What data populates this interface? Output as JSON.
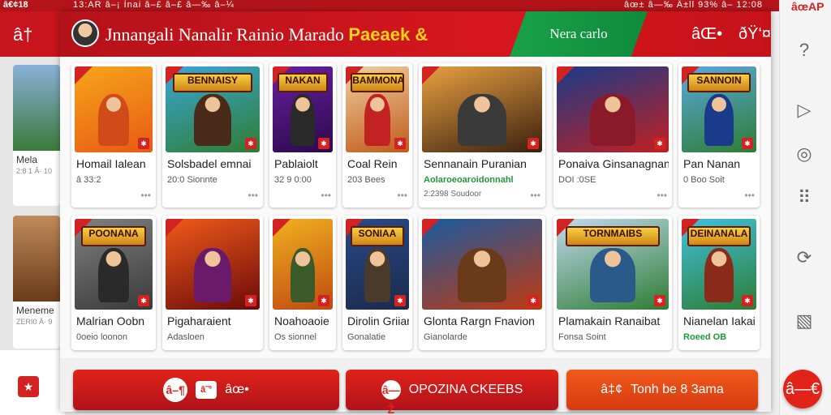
{
  "status_bar": {
    "left": "â€¢18",
    "middle": "13:AR â–¡ Ìnai  â–£ â–£ â—‰ â–¼",
    "right": "âœ± â—‰ Ä±ll 93% â–­ 12:08"
  },
  "rail": {
    "top_label": "âœAP",
    "icons": [
      "help-icon",
      "play-icon",
      "camera-icon",
      "grid-icon",
      "refresh-icon",
      "tag-icon"
    ],
    "fab_icon": "â—€"
  },
  "background_app": {
    "back_icon": "â†",
    "cards": [
      {
        "title": "Mela",
        "subtitle": "2:8 1 Â· 10"
      },
      {
        "title": "Meneme",
        "subtitle": "ZERI0 Â· 9"
      }
    ]
  },
  "header": {
    "title": "Jnnangali Nanalir Rainio Marado",
    "title_accent": "Paeaek &",
    "green_tab_label": "Nera carlo",
    "search_icon": "âŒ•",
    "profile_icon": "ðŸ‘¤"
  },
  "games": [
    {
      "name": "Homail Ialean",
      "meta": "â­ 33:2",
      "banner": "",
      "colors": [
        "#f6a51a",
        "#e85a14"
      ],
      "hero": "#d04a1a"
    },
    {
      "name": "Solsbadel emnai",
      "meta": "20:0 Sionnte",
      "banner": "BENNAISY",
      "colors": [
        "#3aa6d6",
        "#2e7d32"
      ],
      "hero": "#4a2a18"
    },
    {
      "name": "Pablaiolt",
      "meta": "32 9 0:00",
      "banner": "NAKAN",
      "colors": [
        "#6a1fa2",
        "#2a0a4a"
      ],
      "hero": "#2a2a2a"
    },
    {
      "name": "Coal Rein",
      "meta": "203 Bees",
      "banner": "BAMMONA",
      "colors": [
        "#f0d0a0",
        "#c05a1a"
      ],
      "hero": "#c22222"
    },
    {
      "name": "Sennanain Puranian",
      "meta": "Aolaroeoaroidonnahl",
      "sub": "2:2398 Soudoor",
      "banner": "",
      "colors": [
        "#e8a040",
        "#3a2010"
      ],
      "hero": "#3a3a3a",
      "meta_green": true
    },
    {
      "name": "Ponaiva Ginsanagnan",
      "meta": "DOI :0SE",
      "banner": "",
      "colors": [
        "#1a3a8a",
        "#c02020"
      ],
      "hero": "#8a1a2a"
    },
    {
      "name": "Pan Nanan",
      "meta": "0 Boo Soit",
      "banner": "SANNOIN",
      "colors": [
        "#5aa8e0",
        "#2e7d32"
      ],
      "hero": "#1a3a8a"
    },
    {
      "name": "Malrian Oobn",
      "meta": "0oeio loonon",
      "banner": "POONANA",
      "colors": [
        "#808080",
        "#3a3a3a"
      ],
      "hero": "#2a2a2a"
    },
    {
      "name": "Pigaharaient",
      "meta": "Adasloen",
      "banner": "",
      "colors": [
        "#f05a1a",
        "#6a0a0a"
      ],
      "hero": "#6a1a6a"
    },
    {
      "name": "Noahoaoie",
      "meta": "Os sionnel",
      "banner": "",
      "colors": [
        "#f0b020",
        "#c04a10"
      ],
      "hero": "#3a5a2a"
    },
    {
      "name": "Dirolin Griian",
      "meta": "Gonalatie",
      "banner": "SONIAA",
      "colors": [
        "#2a4a8a",
        "#1a2a4a"
      ],
      "hero": "#4a3a2a"
    },
    {
      "name": "Glonta Rargn Fnavion",
      "meta": "Gianolarde",
      "banner": "",
      "colors": [
        "#1a5aa0",
        "#c03a10"
      ],
      "hero": "#6a3a1a"
    },
    {
      "name": "Plamakain Ranaibat",
      "meta": "Fonsa Soint",
      "banner": "TORNMAIBS",
      "colors": [
        "#c0d8f0",
        "#2e7d32"
      ],
      "hero": "#2a5a8a"
    },
    {
      "name": "Nianelan Iakai",
      "meta": "Roeed OB",
      "banner": "DEINANALA",
      "colors": [
        "#40c0e0",
        "#2e7d32"
      ],
      "hero": "#8a2a1a",
      "meta_green": true
    }
  ],
  "actions": [
    {
      "label": "",
      "icons": [
        "â–¶",
        "â˜°",
        "âœ•"
      ],
      "style": "red"
    },
    {
      "label": "OPOZINA CKEEBS",
      "icons": [
        "â—Ž"
      ],
      "style": "red"
    },
    {
      "label": "Tonh be 8 3ama",
      "icons": [
        "â‡¢"
      ],
      "style": "orange"
    }
  ]
}
